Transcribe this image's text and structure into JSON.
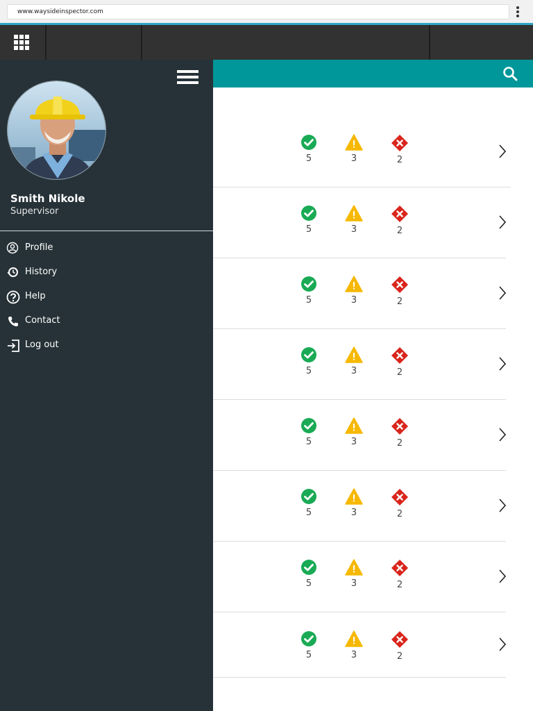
{
  "browser": {
    "url": "www.waysideinspector.com"
  },
  "user": {
    "name": "Smith Nikole",
    "role": "Supervisor"
  },
  "menu": [
    {
      "label": "Profile",
      "icon": "profile-icon"
    },
    {
      "label": "History",
      "icon": "history-icon"
    },
    {
      "label": "Help",
      "icon": "help-icon"
    },
    {
      "label": "Contact",
      "icon": "phone-icon"
    },
    {
      "label": "Log out",
      "icon": "logout-icon"
    }
  ],
  "rows": [
    {
      "passed": "5",
      "warnings": "3",
      "failed": "2"
    },
    {
      "passed": "5",
      "warnings": "3",
      "failed": "2"
    },
    {
      "passed": "5",
      "warnings": "3",
      "failed": "2"
    },
    {
      "passed": "5",
      "warnings": "3",
      "failed": "2"
    },
    {
      "passed": "5",
      "warnings": "3",
      "failed": "2"
    },
    {
      "passed": "5",
      "warnings": "3",
      "failed": "2"
    },
    {
      "passed": "5",
      "warnings": "3",
      "failed": "2"
    },
    {
      "passed": "5",
      "warnings": "3",
      "failed": "2"
    }
  ],
  "colors": {
    "teal": "#00979a",
    "drawer": "#263238",
    "pass": "#1aaa55",
    "warn": "#f6b800",
    "fail": "#d9251c"
  }
}
